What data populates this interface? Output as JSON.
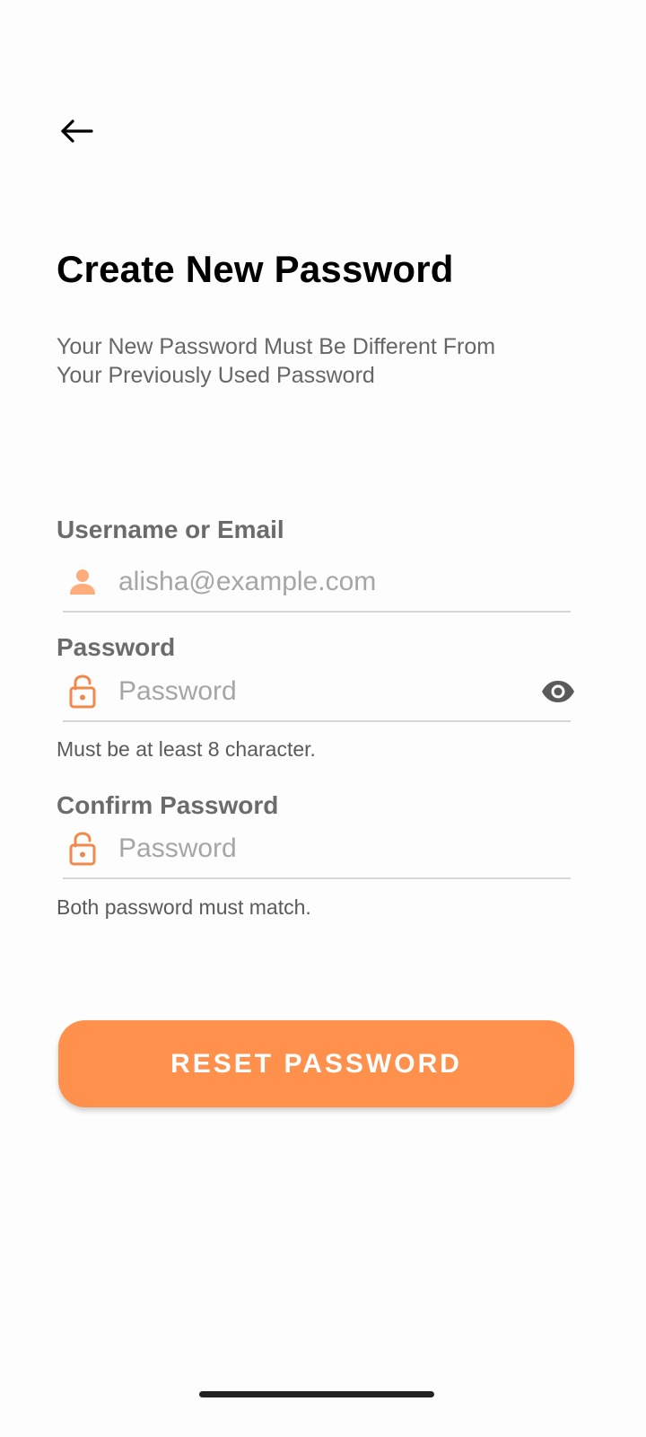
{
  "header": {
    "back_icon": "arrow-left-icon"
  },
  "title": "Create New Password",
  "subtitle": {
    "line1": "Your New Password Must Be Different From",
    "line2": "Your Previously Used Password"
  },
  "form": {
    "username": {
      "label": "Username or Email",
      "placeholder": "alisha@example.com",
      "icon": "person-icon"
    },
    "password": {
      "label": "Password",
      "placeholder": "Password",
      "hint": "Must be at least 8 character.",
      "icon": "lock-open-icon",
      "toggle_icon": "eye-icon"
    },
    "confirm_password": {
      "label": "Confirm Password",
      "placeholder": "Password",
      "hint": "Both password must match.",
      "icon": "lock-open-icon"
    }
  },
  "submit_label": "RESET PASSWORD",
  "colors": {
    "accent": "#ff914d",
    "label": "#6b6b6b",
    "placeholder": "#a6a6a6",
    "divider": "#d6d6d6"
  }
}
